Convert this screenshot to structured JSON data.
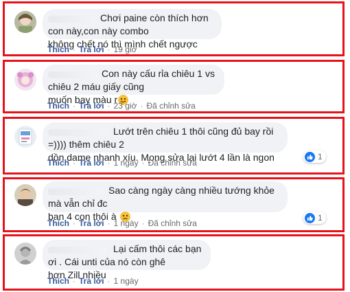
{
  "comments": [
    {
      "text": "Chơi paine còn thích hơn con này,con này combo\nkhông chết nó thì mình chết ngược",
      "actions": {
        "like": "Thích",
        "reply": "Trả lời",
        "time": "19 giờ"
      }
    },
    {
      "text": "Con này cấu rỉa chiêu 1 vs chiêu 2 máu giấy cũng\nmuốn bay màu r",
      "emoji": "smile",
      "actions": {
        "like": "Thích",
        "reply": "Trả lời",
        "time": "23 giờ",
        "edited": "Đã chỉnh sửa"
      }
    },
    {
      "text": "Lướt trên chiêu 1 thôi cũng đủ bay rồi =)))) thêm chiêu 2\ndồn dame nhanh xíu. Mong sửa lại lướt 4 lần là ngon",
      "reaction_count": "1",
      "actions": {
        "like": "Thích",
        "reply": "Trả lời",
        "time": "1 ngày",
        "edited": "Đã chỉnh sửa"
      }
    },
    {
      "text": "Sao càng ngày càng nhiều tướng khỏe mà vẫn chỉ đc\nban 4 con thôi à",
      "emoji": "sad",
      "reaction_count": "1",
      "actions": {
        "like": "Thích",
        "reply": "Trả lời",
        "time": "1 ngày",
        "edited": "Đã chỉnh sửa"
      }
    },
    {
      "text": "Lại cấm thôi các bạn ơi . Cái unti của nó còn ghê\nhơn Zill nhiều",
      "actions": {
        "like": "Thích",
        "reply": "Trả lời",
        "time": "1 ngày"
      }
    }
  ],
  "colors": {
    "frame": "#e8111a",
    "bubble": "#f0f2f5",
    "link": "#385898",
    "like_blue": "#1877f2"
  },
  "icons": [
    "like-icon",
    "smile-emoji-icon",
    "sad-emoji-icon",
    "avatar"
  ]
}
